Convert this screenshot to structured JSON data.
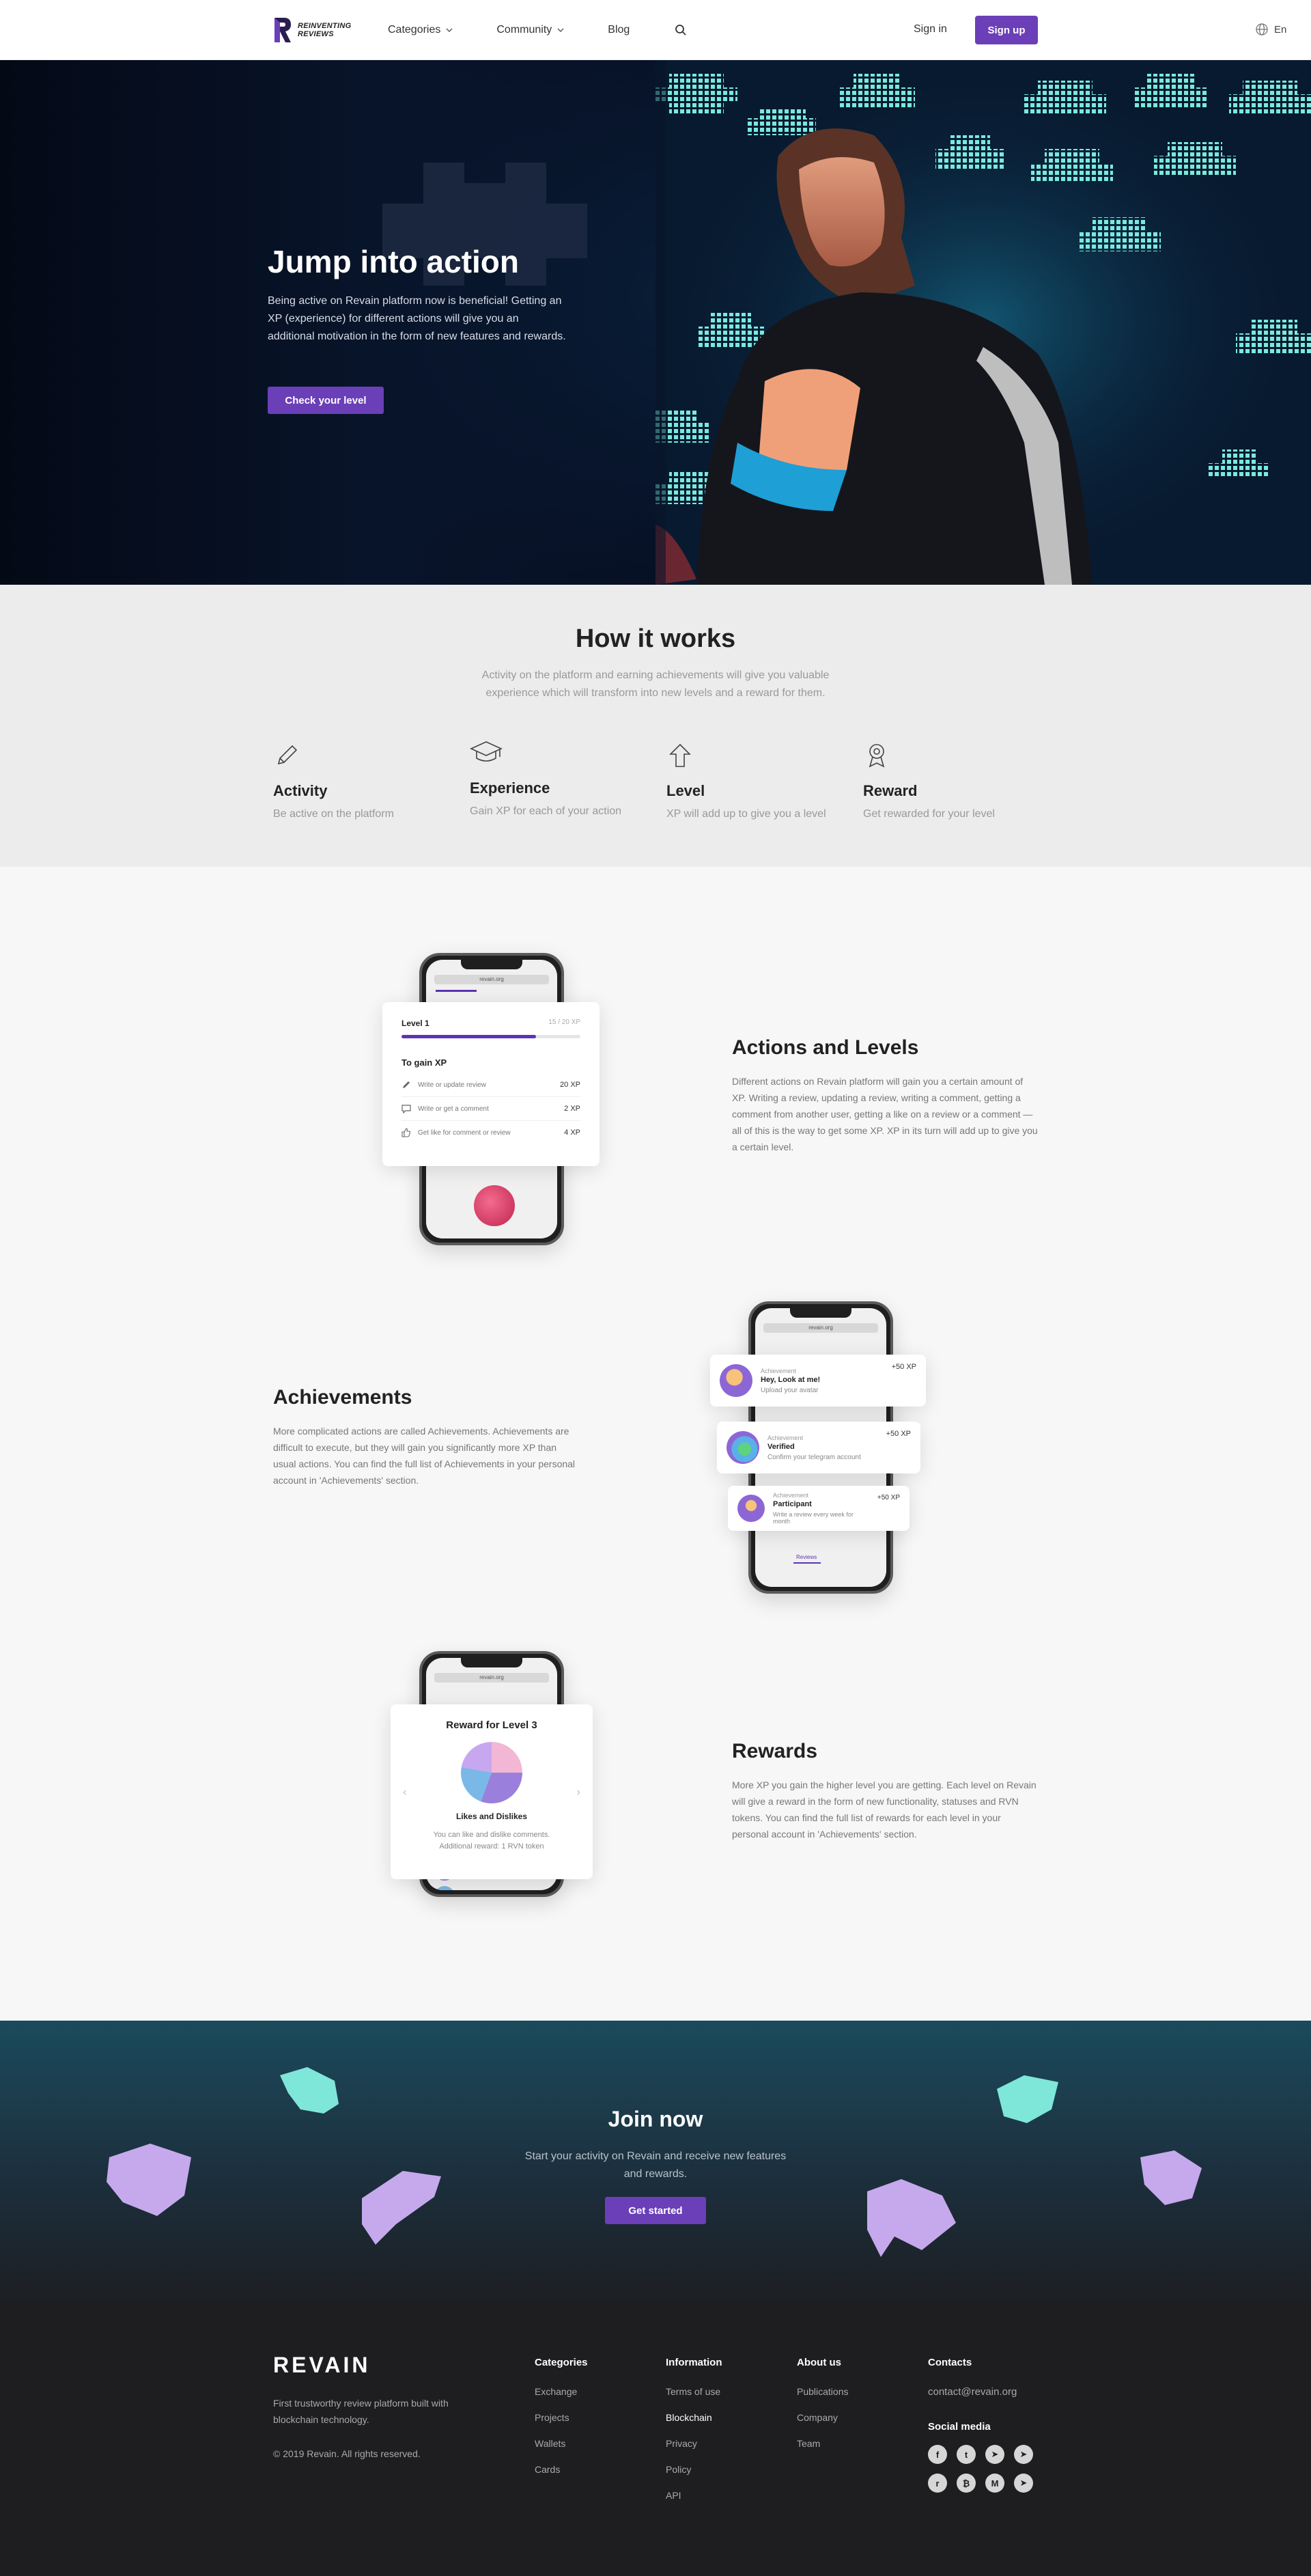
{
  "header": {
    "logo_text_line1": "REINVENTING",
    "logo_text_line2": "REVIEWS",
    "nav": [
      {
        "label": "Categories"
      },
      {
        "label": "Community"
      },
      {
        "label": "Blog"
      }
    ],
    "sign_in": "Sign in",
    "sign_up": "Sign up",
    "language": "En"
  },
  "hero": {
    "title": "Jump into action",
    "text": "Being active on Revain platform now is beneficial! Getting an XP (experience) for different actions will give you an additional motivation in the form of new features and rewards.",
    "button": "Check your level"
  },
  "how": {
    "title": "How it works",
    "subtitle": "Activity on the platform and earning achievements will give you valuable experience which will transform into new levels and a reward for them.",
    "features": [
      {
        "title": "Activity",
        "text": "Be active on the platform",
        "icon": "pencil-icon"
      },
      {
        "title": "Experience",
        "text": "Gain XP for each of your action",
        "icon": "graduation-cap-icon"
      },
      {
        "title": "Level",
        "text": "XP will add up to give you a level",
        "icon": "arrow-up-icon"
      },
      {
        "title": "Reward",
        "text": "Get rewarded for your level",
        "icon": "medal-icon"
      }
    ]
  },
  "actions": {
    "title": "Actions and Levels",
    "text": "Different actions on Revain platform will gain you a certain amount of XP. Writing a review, updating a review, writing a comment, getting a comment from another user, getting a like on a review or a comment — all of this is the way to get some XP. XP in its turn will add up to give you a certain level.",
    "card": {
      "level": "Level 1",
      "xp": "15 / 20 XP",
      "progress": 0.75,
      "gain_title": "To gain XP",
      "rows": [
        {
          "label": "Write or update review",
          "xp": "20 XP"
        },
        {
          "label": "Write or get a comment",
          "xp": "2 XP"
        },
        {
          "label": "Get like for comment or review",
          "xp": "4 XP"
        }
      ]
    }
  },
  "achievements": {
    "title": "Achievements",
    "text": "More complicated actions are called Achievements. Achievements are difficult to execute, but they will gain you significantly more XP than usual actions. You can find the full list of Achievements in your personal account in 'Achievements' section.",
    "cards": [
      {
        "kicker": "Achievement",
        "title": "Hey, Look at me!",
        "sub": "Upload your avatar",
        "xp": "+50 XP"
      },
      {
        "kicker": "Achievement",
        "title": "Verified",
        "sub": "Confirm your telegram account",
        "xp": "+50 XP"
      },
      {
        "kicker": "Achievement",
        "title": "Participant",
        "sub": "Write a review every week for month",
        "xp": "+50 XP"
      }
    ],
    "phone_tabs": [
      "Reviews"
    ]
  },
  "rewards": {
    "title": "Rewards",
    "text": "More XP you gain the higher level you are getting. Each level on Revain will give a reward in the form of new functionality, statuses and RVN tokens. You can find the full list of rewards for each level in your personal account in 'Achievements' section.",
    "card": {
      "title": "Reward for Level 3",
      "name": "Likes and Dislikes",
      "desc_line1": "You can like and dislike comments.",
      "desc_line2": "Additional reward: 1 RVN token"
    }
  },
  "join": {
    "title": "Join now",
    "subtitle": "Start your activity on Revain and receive new features and rewards.",
    "button": "Get started"
  },
  "footer": {
    "logo": "REVAIN",
    "tagline": "First trustworthy review platform built with blockchain technology.",
    "copyright": "© 2019 Revain. All rights reserved.",
    "columns": [
      {
        "title": "Categories",
        "links": [
          "Exchange",
          "Projects",
          "Wallets",
          "Cards"
        ]
      },
      {
        "title": "Information",
        "links": [
          "Terms of use",
          "Blockchain",
          "Privacy",
          "Policy",
          "API"
        ]
      },
      {
        "title": "About us",
        "links": [
          "Publications",
          "Company",
          "Team"
        ]
      }
    ],
    "contacts": {
      "title": "Contacts",
      "email": "contact@revain.org",
      "social_title": "Social media"
    }
  },
  "colors": {
    "accent": "#6b3fb8",
    "footer_bg": "#1e1e21",
    "section_bg": "#ececec"
  }
}
